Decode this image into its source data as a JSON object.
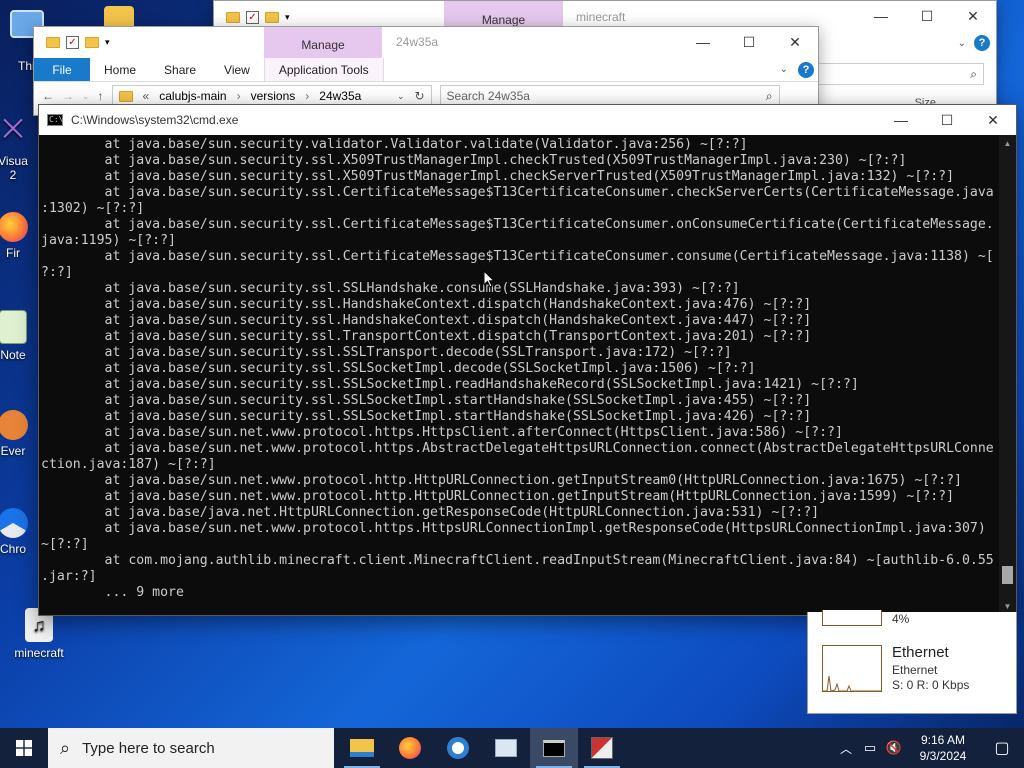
{
  "desktop": {
    "icons": [
      {
        "label": "Visua",
        "label2": "2"
      },
      {
        "label": "Fir"
      },
      {
        "label": "Note"
      },
      {
        "label": "Ever"
      },
      {
        "label": "Chro"
      },
      {
        "label": "minecraft"
      }
    ],
    "this_pc_partial": "Thi"
  },
  "explorer_back": {
    "manage": "Manage",
    "name": "minecraft",
    "column_header": "Size"
  },
  "explorer_front": {
    "manage": "Manage",
    "name": "24w35a",
    "ribbon_tabs": [
      "File",
      "Home",
      "Share",
      "View",
      "Application Tools"
    ],
    "breadcrumb": [
      "calubjs-main",
      "versions",
      "24w35a"
    ],
    "search_placeholder": "Search 24w35a"
  },
  "cmd": {
    "title": "C:\\Windows\\system32\\cmd.exe",
    "lines": [
      "        at java.base/sun.security.validator.Validator.validate(Validator.java:256) ~[?:?]",
      "        at java.base/sun.security.ssl.X509TrustManagerImpl.checkTrusted(X509TrustManagerImpl.java:230) ~[?:?]",
      "        at java.base/sun.security.ssl.X509TrustManagerImpl.checkServerTrusted(X509TrustManagerImpl.java:132) ~[?:?]",
      "        at java.base/sun.security.ssl.CertificateMessage$T13CertificateConsumer.checkServerCerts(CertificateMessage.java",
      ":1302) ~[?:?]",
      "        at java.base/sun.security.ssl.CertificateMessage$T13CertificateConsumer.onConsumeCertificate(CertificateMessage.",
      "java:1195) ~[?:?]",
      "        at java.base/sun.security.ssl.CertificateMessage$T13CertificateConsumer.consume(CertificateMessage.java:1138) ~[",
      "?:?]",
      "        at java.base/sun.security.ssl.SSLHandshake.consume(SSLHandshake.java:393) ~[?:?]",
      "        at java.base/sun.security.ssl.HandshakeContext.dispatch(HandshakeContext.java:476) ~[?:?]",
      "        at java.base/sun.security.ssl.HandshakeContext.dispatch(HandshakeContext.java:447) ~[?:?]",
      "        at java.base/sun.security.ssl.TransportContext.dispatch(TransportContext.java:201) ~[?:?]",
      "        at java.base/sun.security.ssl.SSLTransport.decode(SSLTransport.java:172) ~[?:?]",
      "        at java.base/sun.security.ssl.SSLSocketImpl.decode(SSLSocketImpl.java:1506) ~[?:?]",
      "        at java.base/sun.security.ssl.SSLSocketImpl.readHandshakeRecord(SSLSocketImpl.java:1421) ~[?:?]",
      "        at java.base/sun.security.ssl.SSLSocketImpl.startHandshake(SSLSocketImpl.java:455) ~[?:?]",
      "        at java.base/sun.security.ssl.SSLSocketImpl.startHandshake(SSLSocketImpl.java:426) ~[?:?]",
      "        at java.base/sun.net.www.protocol.https.HttpsClient.afterConnect(HttpsClient.java:586) ~[?:?]",
      "        at java.base/sun.net.www.protocol.https.AbstractDelegateHttpsURLConnection.connect(AbstractDelegateHttpsURLConne",
      "ction.java:187) ~[?:?]",
      "        at java.base/sun.net.www.protocol.http.HttpURLConnection.getInputStream0(HttpURLConnection.java:1675) ~[?:?]",
      "        at java.base/sun.net.www.protocol.http.HttpURLConnection.getInputStream(HttpURLConnection.java:1599) ~[?:?]",
      "        at java.base/java.net.HttpURLConnection.getResponseCode(HttpURLConnection.java:531) ~[?:?]",
      "        at java.base/sun.net.www.protocol.https.HttpsURLConnectionImpl.getResponseCode(HttpsURLConnectionImpl.java:307)",
      "~[?:?]",
      "        at com.mojang.authlib.minecraft.client.MinecraftClient.readInputStream(MinecraftClient.java:84) ~[authlib-6.0.55",
      ".jar:?]",
      "        ... 9 more"
    ],
    "scroll_position": 0.97
  },
  "task_manager": {
    "upper_value": "4%",
    "network_title": "Ethernet",
    "network_subtitle": "Ethernet",
    "network_stats": "S: 0  R: 0 Kbps"
  },
  "taskbar": {
    "search_placeholder": "Type here to search",
    "apps": [
      "file-explorer-icon",
      "firefox-icon",
      "chromium-icon",
      "app-window-icon",
      "cmd-icon",
      "minecraft-launcher-icon"
    ],
    "time": "9:16 AM",
    "date": "9/3/2024"
  }
}
